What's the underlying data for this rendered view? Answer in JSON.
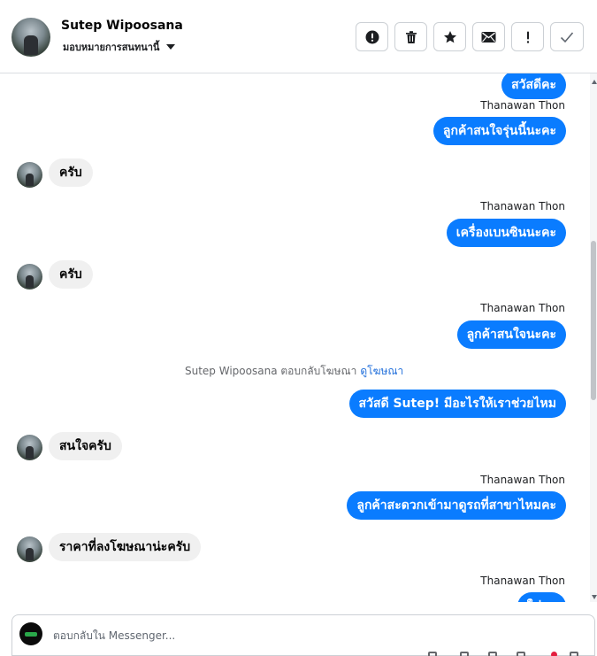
{
  "header": {
    "contact_name": "Sutep Wipoosana",
    "assign_label": "มอบหมายการสนทนานี้",
    "actions": [
      {
        "name": "report-spam-button",
        "icon": "alert-circle-icon"
      },
      {
        "name": "delete-button",
        "icon": "trash-icon"
      },
      {
        "name": "star-button",
        "icon": "star-icon"
      },
      {
        "name": "mark-unread-button",
        "icon": "envelope-icon"
      },
      {
        "name": "follow-up-button",
        "icon": "exclamation-icon"
      },
      {
        "name": "mark-done-button",
        "icon": "check-icon"
      }
    ]
  },
  "thread": {
    "out_1": "สวัสดีคะ",
    "sender_1": "Thanawan Thon",
    "out_2": "ลูกค้าสนใจรุ่นนี้นะคะ",
    "in_1": "ครับ",
    "sender_2": "Thanawan Thon",
    "out_3": "เครื่องเบนซินนะคะ",
    "in_2": "ครับ",
    "sender_3": "Thanawan Thon",
    "out_4": "ลูกค้าสนใจนะคะ",
    "system_text": "Sutep Wipoosana ตอบกลับโฆษณา",
    "system_link": "ดูโฆษณา",
    "out_5": "สวัสดี Sutep! มีอะไรให้เราช่วยไหม",
    "in_3": "สนใจครับ",
    "sender_4": "Thanawan Thon",
    "out_6": "ลูกค้าสะดวกเข้ามาดูรถที่สาขาไหมคะ",
    "in_4": "ราคาที่ลงโฆษณาน่ะครับ",
    "sender_5": "Thanawan Thon",
    "out_7": "ใช่คะ"
  },
  "composer": {
    "placeholder": "ตอบกลับใน Messenger..."
  },
  "colors": {
    "outgoing_bubble": "#0a7cff",
    "incoming_bubble": "#f0f0f0",
    "link": "#216fdb"
  }
}
